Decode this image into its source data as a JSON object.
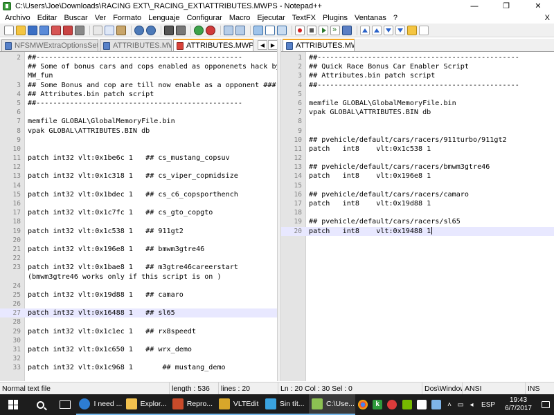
{
  "window": {
    "title": "C:\\Users\\Joe\\Downloads\\RACING EXT\\_RACING_EXT\\ATTRIBUTES.MWPS - Notepad++",
    "minimize_label": "—",
    "maximize_label": "❐",
    "close_label": "✕"
  },
  "menu": {
    "items": [
      "Archivo",
      "Editar",
      "Buscar",
      "Ver",
      "Formato",
      "Lenguaje",
      "Configurar",
      "Macro",
      "Ejecutar",
      "TextFX",
      "Plugins",
      "Ventanas",
      "?"
    ],
    "close_label": "X"
  },
  "toolbar": {
    "icons": [
      "new-file-icon",
      "open-file-icon",
      "save-icon",
      "save-all-icon",
      "close-icon",
      "close-all-icon",
      "print-icon",
      "cut-icon",
      "copy-icon",
      "paste-icon",
      "undo-icon",
      "redo-icon",
      "find-icon",
      "replace-icon",
      "zoom-in-icon",
      "zoom-out-icon",
      "sync-scroll-icon",
      "word-wrap-icon",
      "show-all-chars-icon",
      "indent-guide-icon",
      "record-macro-icon",
      "stop-macro-icon",
      "play-macro-icon",
      "run-macro-multiple-icon",
      "save-macro-icon",
      "move-up-icon",
      "move-down-icon",
      "spell-check-icon"
    ]
  },
  "left_pane": {
    "tabs": [
      {
        "label": "NFSMWExtraOptionsSettings.ini",
        "state": "saved",
        "active": false
      },
      {
        "label": "ATTRIBUTES.MWPS",
        "state": "saved",
        "active": false
      },
      {
        "label": "ATTRIBUTES.MWPS",
        "state": "unsaved",
        "active": true
      }
    ],
    "nav_prev": "◀",
    "nav_next": "▶",
    "lines": [
      {
        "n": "2",
        "t": "##-------------------------------------------------"
      },
      {
        "n": "",
        "t": "## Some of bonus cars and cops enabled as opponenets hack by"
      },
      {
        "n": "",
        "t": "MW_fun"
      },
      {
        "n": "3",
        "t": "## Some Bonus and cop are till now enable as a opponent ###"
      },
      {
        "n": "4",
        "t": "## Attributes.bin patch script"
      },
      {
        "n": "5",
        "t": "##-------------------------------------------------"
      },
      {
        "n": "6",
        "t": ""
      },
      {
        "n": "7",
        "t": "memfile GLOBAL\\GlobalMemoryFile.bin"
      },
      {
        "n": "8",
        "t": "vpak GLOBAL\\ATTRIBUTES.BIN db"
      },
      {
        "n": "9",
        "t": ""
      },
      {
        "n": "10",
        "t": ""
      },
      {
        "n": "11",
        "t": "patch int32 vlt:0x1be6c 1   ## cs_mustang_copsuv"
      },
      {
        "n": "12",
        "t": ""
      },
      {
        "n": "13",
        "t": "patch int32 vlt:0x1c318 1   ## cs_viper_copmidsize"
      },
      {
        "n": "14",
        "t": ""
      },
      {
        "n": "15",
        "t": "patch int32 vlt:0x1bdec 1   ## cs_c6_copsporthench"
      },
      {
        "n": "16",
        "t": ""
      },
      {
        "n": "17",
        "t": "patch int32 vlt:0x1c7fc 1   ## cs_gto_copgto"
      },
      {
        "n": "18",
        "t": ""
      },
      {
        "n": "19",
        "t": "patch int32 vlt:0x1c538 1   ## 911gt2"
      },
      {
        "n": "20",
        "t": ""
      },
      {
        "n": "21",
        "t": "patch int32 vlt:0x196e8 1   ## bmwm3gtre46"
      },
      {
        "n": "22",
        "t": ""
      },
      {
        "n": "23",
        "t": "patch int32 vlt:0x1bae8 1   ## m3gtre46careerstart"
      },
      {
        "n": "",
        "t": "(bmwm3gtre46 works only if this script is on )"
      },
      {
        "n": "24",
        "t": ""
      },
      {
        "n": "25",
        "t": "patch int32 vlt:0x19d88 1   ## camaro"
      },
      {
        "n": "26",
        "t": ""
      },
      {
        "n": "27",
        "t": "patch int32 vlt:0x16488 1   ## sl65"
      },
      {
        "n": "28",
        "t": ""
      },
      {
        "n": "29",
        "t": "patch int32 vlt:0x1c1ec 1   ## rx8speedt"
      },
      {
        "n": "30",
        "t": ""
      },
      {
        "n": "31",
        "t": "patch int32 vlt:0x1c650 1   ## wrx_demo"
      },
      {
        "n": "32",
        "t": ""
      },
      {
        "n": "33",
        "t": "patch int32 vlt:0x1c968 1       ## mustang_demo"
      }
    ],
    "current_line_index": 28
  },
  "right_pane": {
    "tabs": [
      {
        "label": "ATTRIBUTES.MWPS",
        "state": "saved",
        "active": true
      }
    ],
    "lines": [
      {
        "n": "1",
        "t": "##------------------------------------------------"
      },
      {
        "n": "2",
        "t": "## Quick Race Bonus Car Enabler Script"
      },
      {
        "n": "3",
        "t": "## Attributes.bin patch script"
      },
      {
        "n": "4",
        "t": "##------------------------------------------------"
      },
      {
        "n": "5",
        "t": ""
      },
      {
        "n": "6",
        "t": "memfile GLOBAL\\GlobalMemoryFile.bin"
      },
      {
        "n": "7",
        "t": "vpak GLOBAL\\ATTRIBUTES.BIN db"
      },
      {
        "n": "8",
        "t": ""
      },
      {
        "n": "9",
        "t": ""
      },
      {
        "n": "10",
        "t": "## pvehicle/default/cars/racers/911turbo/911gt2"
      },
      {
        "n": "11",
        "t": "patch   int8    vlt:0x1c538 1"
      },
      {
        "n": "12",
        "t": ""
      },
      {
        "n": "13",
        "t": "## pvehicle/default/cars/racers/bmwm3gtre46"
      },
      {
        "n": "14",
        "t": "patch   int8    vlt:0x196e8 1"
      },
      {
        "n": "15",
        "t": ""
      },
      {
        "n": "16",
        "t": "## pvehicle/default/cars/racers/camaro"
      },
      {
        "n": "17",
        "t": "patch   int8    vlt:0x19d88 1"
      },
      {
        "n": "18",
        "t": ""
      },
      {
        "n": "19",
        "t": "## pvehicle/default/cars/racers/sl65"
      },
      {
        "n": "20",
        "t": "patch   int8    vlt:0x19488 1"
      }
    ],
    "current_line_index": 19
  },
  "statusbar": {
    "file_type": "Normal text file",
    "length": "length : 536",
    "lines": "lines : 20",
    "position": "Ln : 20   Col : 30   Sel : 0",
    "eol": "Dos\\Windows",
    "encoding": "ANSI",
    "mode": "INS"
  },
  "taskbar": {
    "items": [
      {
        "label": "I need ...",
        "icon": "edge"
      },
      {
        "label": "Explor...",
        "icon": "explorer"
      },
      {
        "label": "Repro...",
        "icon": "repro"
      },
      {
        "label": "VLTEdit",
        "icon": "vlt"
      },
      {
        "label": "Sin tít...",
        "icon": "sintit"
      },
      {
        "label": "C:\\Use...",
        "icon": "npp"
      }
    ],
    "language": "ESP",
    "time": "19:43",
    "date": "6/7/2017"
  }
}
